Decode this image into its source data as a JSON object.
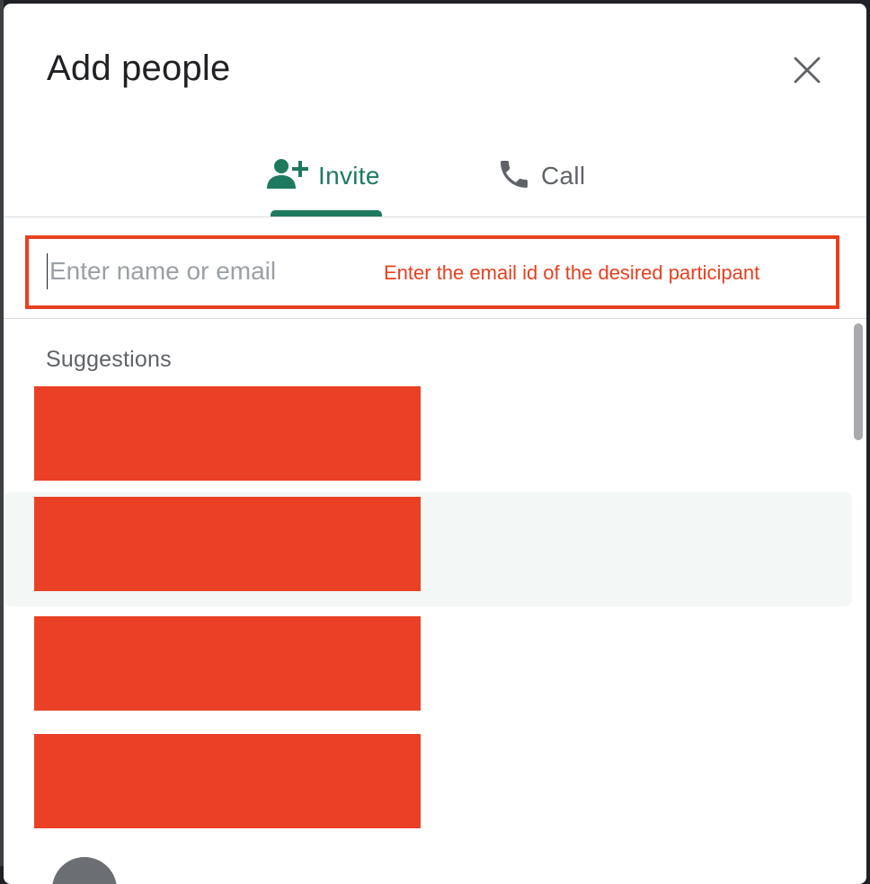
{
  "dialog": {
    "title": "Add people",
    "close_icon": "close-icon"
  },
  "tabs": [
    {
      "label": "Invite",
      "icon": "person-add-icon",
      "selected": true
    },
    {
      "label": "Call",
      "icon": "phone-icon",
      "selected": false
    }
  ],
  "search": {
    "placeholder": "Enter name or email",
    "value": ""
  },
  "annotation": {
    "text": "Enter the email id of the desired participant",
    "color": "#e8401f"
  },
  "suggestions": {
    "title": "Suggestions",
    "items_redacted": 4
  },
  "colors": {
    "accent": "#1e7a5f",
    "redaction": "#ea4025",
    "hover_row": "#f3f7f5"
  }
}
